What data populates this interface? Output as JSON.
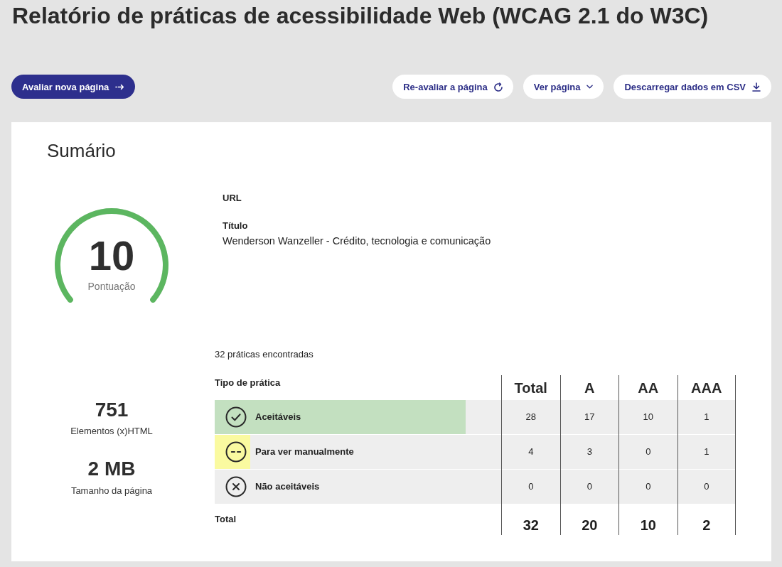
{
  "title": "Relatório de práticas de acessibilidade Web (WCAG 2.1 do W3C)",
  "actions": [
    {
      "label": "Avaliar nova página",
      "kind": "new"
    },
    {
      "label": "Re-avaliar a página",
      "kind": "reload"
    },
    {
      "label": "Ver página",
      "kind": "menu"
    },
    {
      "label": "Descarregar dados em CSV",
      "kind": "download"
    }
  ],
  "summary": {
    "heading": "Sumário",
    "score": {
      "value": "10",
      "label": "Pontuação",
      "level": 1
    },
    "url_label": "URL",
    "title_label": "Título",
    "title_value": "Wenderson Wanzeller - Crédito, tecnologia e comunicação",
    "stats": [
      {
        "value": "751",
        "label": "Elementos (x)HTML"
      },
      {
        "value": "2 MB",
        "label": "Tamanho da página"
      }
    ],
    "practices": {
      "count_text": "32 práticas encontradas",
      "type_header": "Tipo de prática",
      "columns": [
        "Total",
        "A",
        "AA",
        "AAA"
      ],
      "rows": [
        {
          "kind": "accepted",
          "label": "Aceitáveis",
          "color": "#c3e0c0",
          "level": 0.875,
          "cells": [
            "28",
            "17",
            "10",
            "1"
          ]
        },
        {
          "kind": "manual",
          "label": "Para ver manualmente",
          "color": "#fafaa0",
          "level": 0.125,
          "cells": [
            "4",
            "3",
            "0",
            "1"
          ]
        },
        {
          "kind": "rejected",
          "label": "Não aceitáveis",
          "cells": [
            "0",
            "0",
            "0",
            "0"
          ]
        }
      ],
      "total": {
        "label": "Total",
        "cells": [
          "32",
          "20",
          "10",
          "2"
        ]
      }
    }
  }
}
